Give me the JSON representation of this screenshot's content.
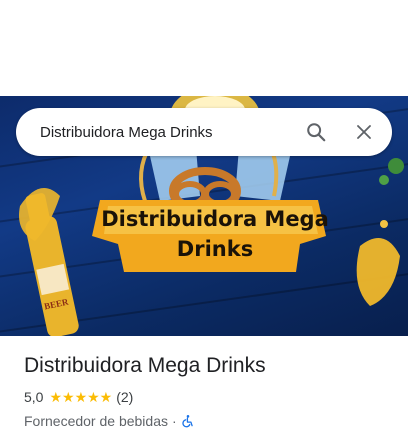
{
  "search": {
    "query": "Distribuidora Mega Drinks"
  },
  "hero": {
    "banner_line1": "Distribuidora Mega",
    "banner_line2": "Drinks",
    "beer_label": "BEER"
  },
  "place": {
    "name": "Distribuidora Mega Drinks",
    "rating": "5,0",
    "stars": "★★★★★",
    "reviews": "(2)",
    "category": "Fornecedor de bebidas",
    "separator": "·"
  },
  "colors": {
    "star": "#fbbc04",
    "accessibility": "#1a73e8",
    "hero_bg": "#123a86"
  },
  "icons": {
    "search": "search-icon",
    "close": "close-icon",
    "accessibility": "wheelchair-icon"
  }
}
